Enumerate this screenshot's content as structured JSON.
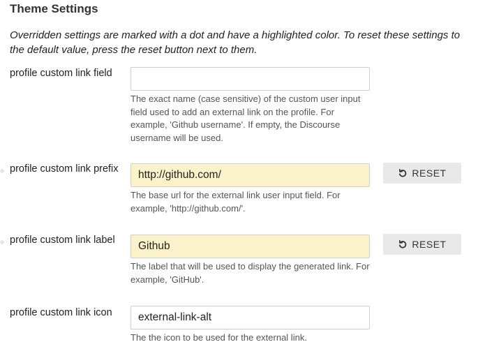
{
  "page": {
    "heading": "Theme Settings",
    "intro": "Overridden settings are marked with a dot and have a highlighted color. To reset these settings to the default value, press the reset button next to them."
  },
  "icons": {
    "reset": "undo-icon"
  },
  "colors": {
    "overridden_field": "#fbf2c9",
    "reset_button": "#e9e9e9",
    "override_dot": "#e6e6e6"
  },
  "settings": [
    {
      "label": "profile custom link field",
      "value": "",
      "description": "The exact name (case sensitive) of the custom user input field used to add an external link on the profile. For example, 'Github username'. If empty, the Discourse username will be used.",
      "overridden": false
    },
    {
      "label": "profile custom link prefix",
      "value": "http://github.com/",
      "description": "The base url for the external link user input field. For example, 'http://github.com/'.",
      "overridden": true,
      "reset_label": "RESET"
    },
    {
      "label": "profile custom link label",
      "value": "Github",
      "description": "The label that will be used to display the generated link. For example, 'GitHub'.",
      "overridden": true,
      "reset_label": "RESET"
    },
    {
      "label": "profile custom link icon",
      "value": "external-link-alt",
      "description": "The the icon to be used for the external link.",
      "overridden": false
    }
  ]
}
